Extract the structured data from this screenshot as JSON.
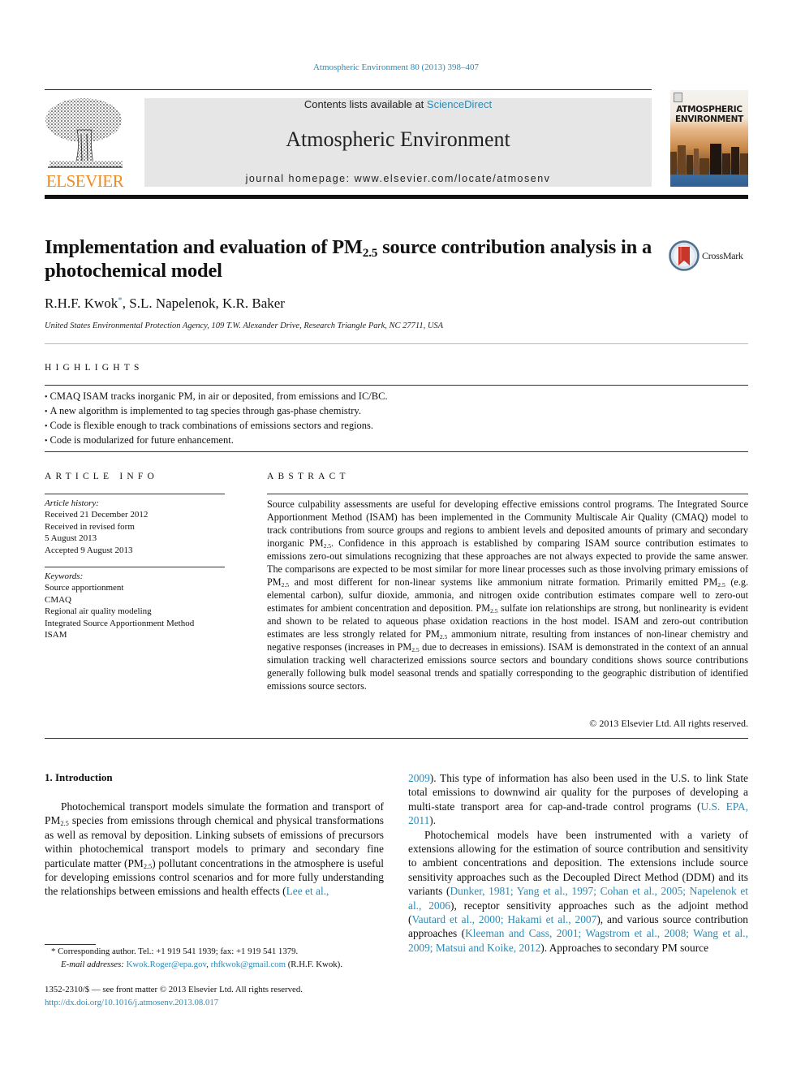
{
  "header": {
    "citation": "Atmospheric Environment 80 (2013) 398–407",
    "publisher_logo_text": "ELSEVIER",
    "contents_prefix": "Contents lists available at ",
    "contents_link": "ScienceDirect",
    "journal_title": "Atmospheric Environment",
    "homepage": "journal homepage: www.elsevier.com/locate/atmosenv",
    "cover_title_line1": "ATMOSPHERIC",
    "cover_title_line2": "ENVIRONMENT",
    "colors": {
      "link": "#2a8bb8",
      "elsevier_orange": "#f08a24",
      "banner_bg": "#e6e6e6"
    }
  },
  "article": {
    "title_part1": "Implementation and evaluation of PM",
    "title_sub": "2.5",
    "title_part2": " source contribution analysis in a photochemical model",
    "crossmark_label": "CrossMark",
    "authors": [
      {
        "name": "R.H.F. Kwok",
        "mark": "*"
      },
      {
        "name": "S.L. Napelenok"
      },
      {
        "name": "K.R. Baker"
      }
    ],
    "author_sep": ", ",
    "affiliation": "United States Environmental Protection Agency, 109 T.W. Alexander Drive, Research Triangle Park, NC 27711, USA"
  },
  "highlights": {
    "heading": "HIGHLIGHTS",
    "items": [
      "CMAQ ISAM tracks inorganic PM, in air or deposited, from emissions and IC/BC.",
      "A new algorithm is implemented to tag species through gas-phase chemistry.",
      "Code is flexible enough to track combinations of emissions sectors and regions.",
      "Code is modularized for future enhancement."
    ]
  },
  "article_info": {
    "heading": "ARTICLE INFO",
    "history_label": "Article history:",
    "history": [
      "Received 21 December 2012",
      "Received in revised form",
      "5 August 2013",
      "Accepted 9 August 2013"
    ],
    "keywords_label": "Keywords:",
    "keywords": [
      "Source apportionment",
      "CMAQ",
      "Regional air quality modeling",
      "Integrated Source Apportionment Method",
      "ISAM"
    ]
  },
  "abstract": {
    "heading": "ABSTRACT",
    "segments": [
      "Source culpability assessments are useful for developing effective emissions control programs. The Integrated Source Apportionment Method (ISAM) has been implemented in the Community Multiscale Air Quality (CMAQ) model to track contributions from source groups and regions to ambient levels and deposited amounts of primary and secondary inorganic PM",
      ". Confidence in this approach is established by comparing ISAM source contribution estimates to emissions zero-out simulations recognizing that these approaches are not always expected to provide the same answer. The comparisons are expected to be most similar for more linear processes such as those involving primary emissions of PM",
      " and most different for non-linear systems like ammonium nitrate formation. Primarily emitted PM",
      " (e.g. elemental carbon), sulfur dioxide, ammonia, and nitrogen oxide contribution estimates compare well to zero-out estimates for ambient concentration and deposition. PM",
      " sulfate ion relationships are strong, but nonlinearity is evident and shown to be related to aqueous phase oxidation reactions in the host model. ISAM and zero-out contribution estimates are less strongly related for PM",
      " ammonium nitrate, resulting from instances of non-linear chemistry and negative responses (increases in PM",
      " due to decreases in emissions). ISAM is demonstrated in the context of an annual simulation tracking well characterized emissions source sectors and boundary conditions shows source contributions generally following bulk model seasonal trends and spatially corresponding to the geographic distribution of identified emissions source sectors."
    ],
    "sub": "2.5",
    "copyright": "© 2013 Elsevier Ltd. All rights reserved."
  },
  "body": {
    "intro_heading": "1.  Introduction",
    "left_p1": [
      "Photochemical transport models simulate the formation and transport of PM",
      " species from emissions through chemical and physical transformations as well as removal by deposition. Linking subsets of emissions of precursors within photochemical transport models to primary and secondary fine particulate matter (PM",
      ") pollutant concentrations in the atmosphere is useful for developing emissions control scenarios and for more fully understanding the relationships between emissions and health effects ("
    ],
    "ref_lee_a": "Lee et al.,",
    "ref_lee_b": "2009",
    "right_p1_text": "). This type of information has also been used in the U.S. to link State total emissions to downwind air quality for the purposes of developing a multi-state transport area for cap-and-trade control programs (",
    "ref_epa": "U.S. EPA, 2011",
    "right_p1_end": ").",
    "right_p2_a": "Photochemical models have been instrumented with a variety of extensions allowing for the estimation of source contribution and sensitivity to ambient concentrations and deposition. The extensions include source sensitivity approaches such as the Decoupled Direct Method (DDM) and its variants (",
    "ref_ddm": "Dunker, 1981; Yang et al., 1997; Cohan et al., 2005; Napelenok et al., 2006",
    "right_p2_b": "), receptor sensitivity approaches such as the adjoint method (",
    "ref_adjoint": "Vautard et al., 2000; Hakami et al., 2007",
    "right_p2_c": "), and various source contribution approaches (",
    "ref_contrib": "Kleeman and Cass, 2001; Wagstrom et al., 2008; Wang et al., 2009; Matsui and Koike, 2012",
    "right_p2_d": "). Approaches to secondary PM source"
  },
  "footnotes": {
    "corresponding": "* Corresponding author. Tel.: +1 919 541 1939; fax: +1 919 541 1379.",
    "email_label": "E-mail addresses:",
    "email1": "Kwok.Roger@epa.gov",
    "email_sep": ", ",
    "email2": "rhfkwok@gmail.com",
    "email_suffix": " (R.H.F. Kwok).",
    "issn": "1352-2310/$ — see front matter © 2013 Elsevier Ltd. All rights reserved.",
    "doi": "http://dx.doi.org/10.1016/j.atmosenv.2013.08.017"
  }
}
